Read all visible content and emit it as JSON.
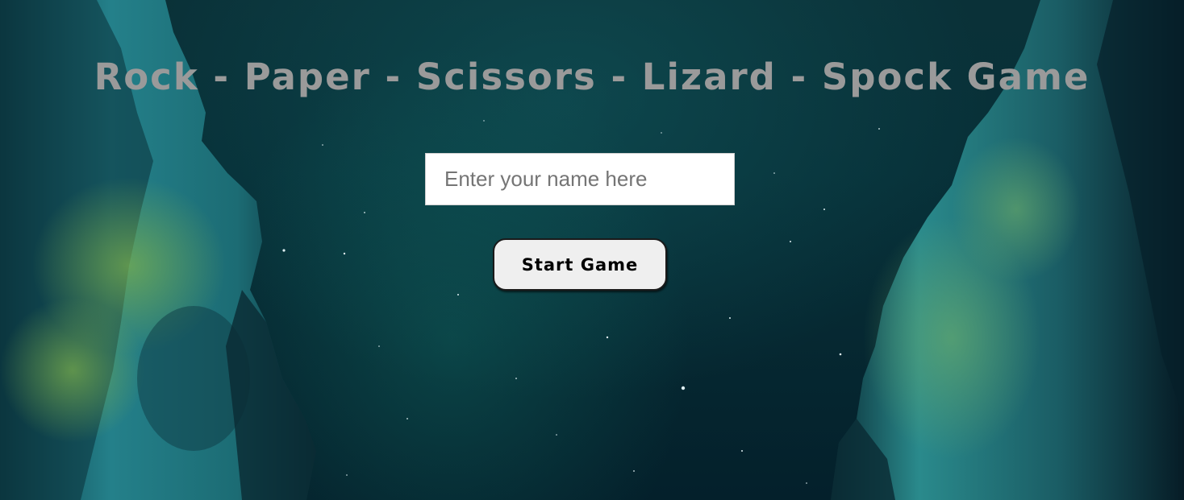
{
  "page": {
    "title": "Rock - Paper - Scissors - Lizard - Spock Game",
    "background": "night-sky-canyon"
  },
  "form": {
    "name_placeholder": "Enter your name here",
    "name_value": "",
    "start_label": "Start Game"
  },
  "colors": {
    "title": "#9a9a9a",
    "sky": "#073038",
    "cliff": "#1d6e78",
    "moss": "#5c9b4a",
    "button_bg": "#efefef"
  }
}
